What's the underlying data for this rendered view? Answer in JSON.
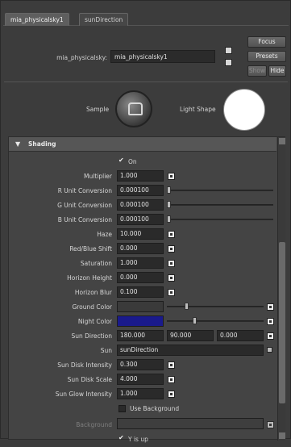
{
  "tabs": [
    {
      "label": "mia_physicalsky1",
      "active": true
    },
    {
      "label": "sunDirection",
      "active": false
    }
  ],
  "node": {
    "label": "mia_physicalsky:",
    "value": "mia_physicalsky1"
  },
  "buttons": {
    "focus": "Focus",
    "presets": "Presets",
    "show": "Show",
    "hide": "Hide"
  },
  "swatches": {
    "sample_label": "Sample",
    "light_shape_label": "Light Shape"
  },
  "section": {
    "title": "Shading",
    "on_label": "On",
    "multiplier": {
      "label": "Multiplier",
      "value": "1.000"
    },
    "r_unit": {
      "label": "R Unit Conversion",
      "value": "0.000100"
    },
    "g_unit": {
      "label": "G Unit Conversion",
      "value": "0.000100"
    },
    "b_unit": {
      "label": "B Unit Conversion",
      "value": "0.000100"
    },
    "haze": {
      "label": "Haze",
      "value": "10.000"
    },
    "red_blue_shift": {
      "label": "Red/Blue Shift",
      "value": "0.000"
    },
    "saturation": {
      "label": "Saturation",
      "value": "1.000"
    },
    "horizon_height": {
      "label": "Horizon Height",
      "value": "0.000"
    },
    "horizon_blur": {
      "label": "Horizon Blur",
      "value": "0.100"
    },
    "ground_color": {
      "label": "Ground Color",
      "color": "#3a3a3a"
    },
    "night_color": {
      "label": "Night Color",
      "color": "#1a1a8c"
    },
    "sun_direction": {
      "label": "Sun Direction",
      "x": "180.000",
      "y": "90.000",
      "z": "0.000"
    },
    "sun": {
      "label": "Sun",
      "value": "sunDirection"
    },
    "sun_disk_intensity": {
      "label": "Sun Disk Intensity",
      "value": "0.300"
    },
    "sun_disk_scale": {
      "label": "Sun Disk Scale",
      "value": "4.000"
    },
    "sun_glow_intensity": {
      "label": "Sun Glow Intensity",
      "value": "1.000"
    },
    "use_background": {
      "label": "Use Background"
    },
    "background": {
      "label": "Background"
    },
    "y_is_up": {
      "label": "Y is up"
    }
  },
  "colors": {
    "panel": "#3c3c3c",
    "field": "#2a2a2a",
    "night": "#1a1a8c"
  }
}
